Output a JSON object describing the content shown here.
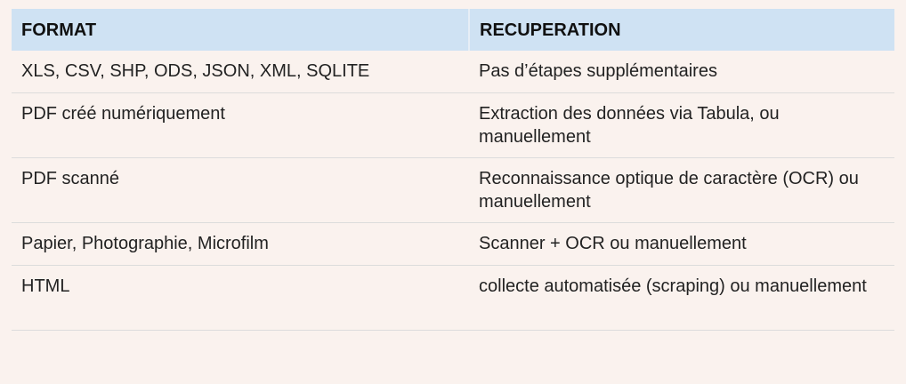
{
  "table": {
    "headers": [
      "FORMAT",
      "RECUPERATION"
    ],
    "rows": [
      [
        "XLS, CSV, SHP, ODS, JSON, XML, SQLITE",
        "Pas d’étapes supplémentaires"
      ],
      [
        "PDF créé numériquement",
        "Extraction des données via Tabula, ou manuellement"
      ],
      [
        "PDF scanné",
        "Reconnaissance optique de caractère (OCR) ou manuellement"
      ],
      [
        "Papier, Photographie, Microfilm",
        "Scanner + OCR ou manuellement"
      ],
      [
        "HTML",
        "collecte automatisée (scraping) ou manuellement"
      ]
    ]
  },
  "colors": {
    "background": "#faf2ee",
    "header_background": "#cfe2f3",
    "row_divider": "#dcdcdc"
  }
}
